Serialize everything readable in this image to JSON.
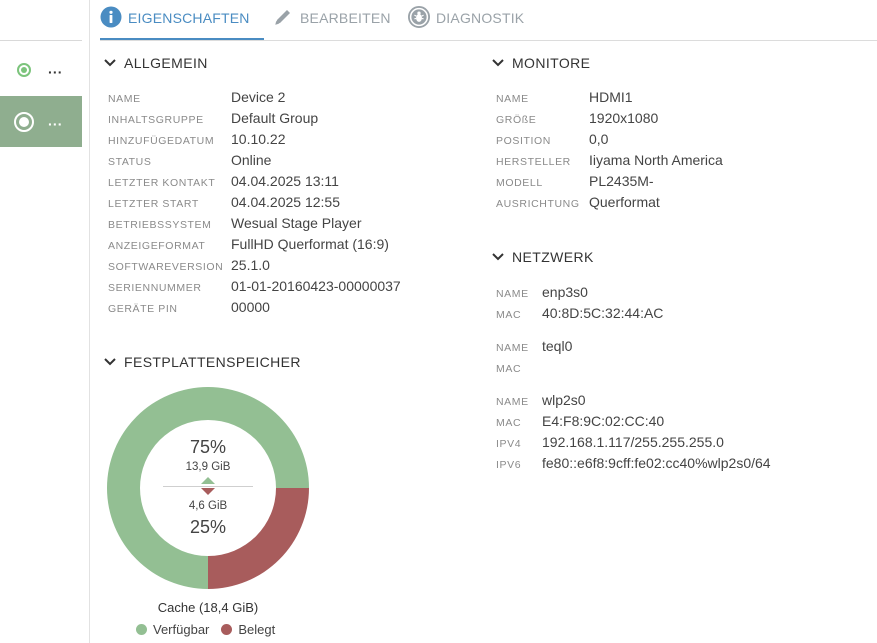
{
  "sidebar": {
    "devices": [
      {
        "menu": "..."
      },
      {
        "menu": "..."
      }
    ]
  },
  "tabs": [
    {
      "label": "EIGENSCHAFTEN",
      "icon": "info-icon",
      "active": true
    },
    {
      "label": "BEARBEITEN",
      "icon": "pencil-icon",
      "active": false
    },
    {
      "label": "DIAGNOSTIK",
      "icon": "bug-icon",
      "active": false
    }
  ],
  "allgemein": {
    "title": "ALLGEMEIN",
    "rows": [
      {
        "key": "NAME",
        "value": "Device 2"
      },
      {
        "key": "INHALTSGRUPPE",
        "value": "Default Group"
      },
      {
        "key": "HINZUFÜGEDATUM",
        "value": "10.10.22"
      },
      {
        "key": "STATUS",
        "value": "Online"
      },
      {
        "key": "LETZTER KONTAKT",
        "value": "04.04.2025 13:11"
      },
      {
        "key": "LETZTER START",
        "value": "04.04.2025 12:55"
      },
      {
        "key": "BETRIEBSSYSTEM",
        "value": "Wesual Stage Player"
      },
      {
        "key": "ANZEIGEFORMAT",
        "value": "FullHD Querformat (16:9)"
      },
      {
        "key": "SOFTWAREVERSION",
        "value": "25.1.0"
      },
      {
        "key": "SERIENNUMMER",
        "value": "01-01-20160423-00000037"
      },
      {
        "key": "GERÄTE PIN",
        "value": "00000"
      }
    ]
  },
  "monitore": {
    "title": "MONITORE",
    "rows": [
      {
        "key": "NAME",
        "value": "HDMI1"
      },
      {
        "key": "GRÖßE",
        "value": "1920x1080"
      },
      {
        "key": "POSITION",
        "value": "0,0"
      },
      {
        "key": "HERSTELLER",
        "value": "Iiyama North America"
      },
      {
        "key": "MODELL",
        "value": "PL2435M-"
      },
      {
        "key": "AUSRICHTUNG",
        "value": "Querformat"
      }
    ]
  },
  "netzwerk": {
    "title": "NETZWERK",
    "interfaces": [
      {
        "rows": [
          {
            "key": "NAME",
            "value": "enp3s0"
          },
          {
            "key": "MAC",
            "value": "40:8D:5C:32:44:AC"
          }
        ]
      },
      {
        "rows": [
          {
            "key": "NAME",
            "value": "teql0"
          },
          {
            "key": "MAC",
            "value": ""
          }
        ]
      },
      {
        "rows": [
          {
            "key": "NAME",
            "value": "wlp2s0"
          },
          {
            "key": "MAC",
            "value": "E4:F8:9C:02:CC:40"
          },
          {
            "key": "IPV4",
            "value": "192.168.1.117/255.255.255.0"
          },
          {
            "key": "IPV6",
            "value": "fe80::e6f8:9cff:fe02:cc40%wlp2s0/64"
          }
        ]
      }
    ]
  },
  "speicher": {
    "title": "FESTPLATTENSPEICHER",
    "free_percent": "75%",
    "free_size": "13,9 GiB",
    "used_size": "4,6 GiB",
    "used_percent": "25%",
    "caption": "Cache (18,4 GiB)",
    "legend_free": "Verfügbar",
    "legend_used": "Belegt",
    "color_free": "#93bf93",
    "color_used": "#a85c5c"
  },
  "chart_data": {
    "type": "pie",
    "categories": [
      "Verfügbar",
      "Belegt"
    ],
    "values": [
      75,
      25
    ],
    "labels": [
      "13,9 GiB",
      "4,6 GiB"
    ],
    "title": "Cache (18,4 GiB)",
    "legend": "bottom"
  }
}
